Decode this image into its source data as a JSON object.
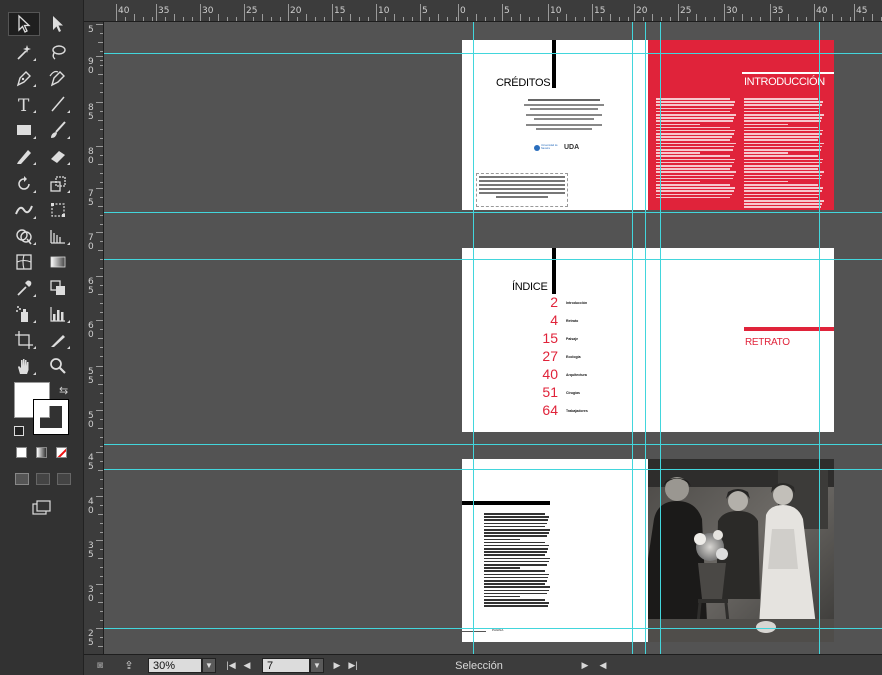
{
  "tools": [
    {
      "name": "selection-tool-icon"
    },
    {
      "name": "direct-selection-tool-icon"
    },
    {
      "name": "magic-wand-tool-icon"
    },
    {
      "name": "lasso-tool-icon"
    },
    {
      "name": "pen-tool-icon"
    },
    {
      "name": "curvature-pen-tool-icon"
    },
    {
      "name": "type-tool-icon"
    },
    {
      "name": "line-segment-tool-icon"
    },
    {
      "name": "rectangle-tool-icon"
    },
    {
      "name": "paintbrush-tool-icon"
    },
    {
      "name": "pencil-tool-icon"
    },
    {
      "name": "eraser-tool-icon"
    },
    {
      "name": "rotate-tool-icon"
    },
    {
      "name": "scale-tool-icon"
    },
    {
      "name": "width-tool-icon"
    },
    {
      "name": "free-transform-tool-icon"
    },
    {
      "name": "shape-builder-tool-icon"
    },
    {
      "name": "perspective-grid-tool-icon"
    },
    {
      "name": "mesh-tool-icon"
    },
    {
      "name": "gradient-tool-icon"
    },
    {
      "name": "eyedropper-tool-icon"
    },
    {
      "name": "blend-tool-icon"
    },
    {
      "name": "symbol-sprayer-tool-icon"
    },
    {
      "name": "column-graph-tool-icon"
    },
    {
      "name": "artboard-tool-icon"
    },
    {
      "name": "slice-tool-icon"
    },
    {
      "name": "hand-tool-icon"
    },
    {
      "name": "zoom-tool-icon"
    }
  ],
  "ruler": {
    "top_labels": [
      "40",
      "35",
      "30",
      "25",
      "20",
      "15",
      "10",
      "5",
      "0",
      "5",
      "10",
      "15",
      "20",
      "25",
      "30",
      "35",
      "40",
      "45"
    ],
    "left_labels": [
      "5",
      "9\n0",
      "8\n5",
      "8\n0",
      "7\n5",
      "7\n0",
      "6\n5",
      "6\n0",
      "5\n5",
      "5\n0",
      "4\n5",
      "4\n0",
      "3\n5",
      "3\n0",
      "2\n5"
    ]
  },
  "spread1": {
    "creditos_title": "CRÉDITOS",
    "intro_title": "INTRODUCCIÓN",
    "logo1": "Universidad de Navarra",
    "logo2": "UDA"
  },
  "spread2": {
    "indice_title": "ÍNDICE",
    "index": [
      {
        "num": "2",
        "label": "Introducción"
      },
      {
        "num": "4",
        "label": "Retrato"
      },
      {
        "num": "15",
        "label": "Paisaje"
      },
      {
        "num": "27",
        "label": "Ecología"
      },
      {
        "num": "40",
        "label": "Arquitectura"
      },
      {
        "num": "51",
        "label": "Cirugías"
      },
      {
        "num": "64",
        "label": "Trabajadores"
      }
    ],
    "retrato_title": "RETRATO"
  },
  "spread3": {
    "page_number": "PÁGINA"
  },
  "status": {
    "zoom": "30%",
    "artboard_number": "7",
    "tool_name": "Selección"
  },
  "colors": {
    "accent_red": "#e0233a",
    "guide": "#42d6dc"
  }
}
